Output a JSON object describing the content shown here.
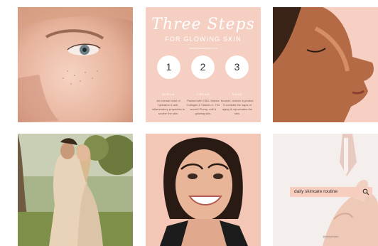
{
  "steps_card": {
    "title": "Three Steps",
    "subtitle": "FOR GLOWING SKIN",
    "url": "www.yourwebsite.com",
    "steps": [
      {
        "number": "1",
        "heading": "SERUM",
        "text": "An intense burst of hydration & anti-inflammatory properties to soothe the skin."
      },
      {
        "number": "2",
        "heading": "CREAM",
        "text": "Packed with CBD, Marine Collagen & Vitamin C. The secret! Plump, soft & glowing skin."
      },
      {
        "number": "3",
        "heading": "MASK",
        "text": "Nourish, restore & protect. It combats the signs of aging & rejuvenates the skin."
      }
    ]
  },
  "search_card": {
    "query": "daily skincare routine",
    "watermark": "@simpleskin"
  },
  "colors": {
    "peach": "#f5cfc2",
    "search_bg": "#f6cdbf"
  },
  "icons": {
    "search": "search-icon"
  }
}
